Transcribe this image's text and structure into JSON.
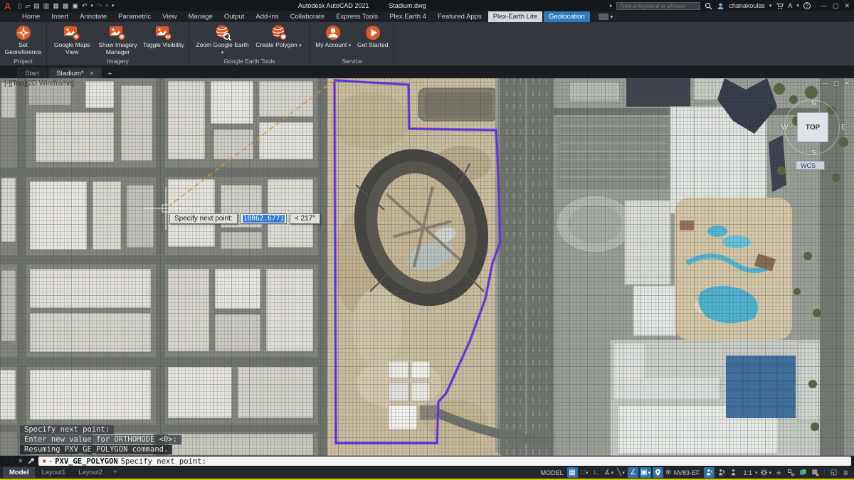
{
  "titlebar": {
    "app_logo": "A",
    "app_title": "Autodesk AutoCAD 2021",
    "doc_title": "Stadium.dwg",
    "search_placeholder": "Type a keyword or phrase",
    "username": "chanakoulas"
  },
  "ribbon_tabs": [
    {
      "label": "Home"
    },
    {
      "label": "Insert"
    },
    {
      "label": "Annotate"
    },
    {
      "label": "Parametric"
    },
    {
      "label": "View"
    },
    {
      "label": "Manage"
    },
    {
      "label": "Output"
    },
    {
      "label": "Add-ins"
    },
    {
      "label": "Collaborate"
    },
    {
      "label": "Express Tools"
    },
    {
      "label": "Plex.Earth 4"
    },
    {
      "label": "Featured Apps"
    },
    {
      "label": "Plex-Earth Lite"
    },
    {
      "label": "Geolocation"
    }
  ],
  "ribbon": {
    "groups": [
      {
        "title": "Project",
        "buttons": [
          {
            "label": "Set Georeference"
          }
        ]
      },
      {
        "title": "Imagery",
        "buttons": [
          {
            "label": "Google Maps View"
          },
          {
            "label": "Show Imagery Manager"
          },
          {
            "label": "Toggle Visibility"
          }
        ]
      },
      {
        "title": "Google Earth Tools",
        "buttons": [
          {
            "label": "Zoom Google Earth"
          },
          {
            "label": "Create Polygon"
          }
        ]
      },
      {
        "title": "Service",
        "buttons": [
          {
            "label": "My Account"
          },
          {
            "label": "Get Started"
          }
        ]
      }
    ]
  },
  "file_tabs": [
    {
      "label": "Start"
    },
    {
      "label": "Stadium*"
    }
  ],
  "canvas": {
    "viewport_label": "[-][Top][2D Wireframe]",
    "viewcube": {
      "n": "N",
      "s": "S",
      "e": "E",
      "w": "W",
      "face": "TOP",
      "wcs": "WCS"
    },
    "tooltip": {
      "label": "Specify next point:",
      "value": "18862.6771",
      "angle": "< 217°"
    },
    "history": [
      "Specify next point:",
      "Enter new value for ORTHOMODE <0>:",
      "Resuming PXV_GE_POLYGON command."
    ]
  },
  "command_bar": {
    "command": "PXV_GE_POLYGON",
    "prompt": "Specify next point:"
  },
  "status_bar": {
    "layout_tabs": [
      "Model",
      "Layout1",
      "Layout2"
    ],
    "model_label": "MODEL",
    "coord_system": "NV83-EF",
    "scale": "1:1"
  },
  "icons": {
    "caret": "▾",
    "close": "✕",
    "minimize": "—",
    "restore": "▢",
    "plus": "+",
    "arrow_right": "▸",
    "undo": "↶",
    "redo": "↷",
    "qat_new": "▯",
    "qat_open": "▱",
    "qat_save": "▤",
    "qat_saveas": "▥",
    "qat_plot": "▦",
    "qat_publish": "▩",
    "qat_print": "▣",
    "grip": "⋮⋮",
    "cmd_badge": "✱",
    "grid": "▦",
    "snap": "∷",
    "ortho": "∟",
    "polar": "∡",
    "isodraft": "╲",
    "osnap_track": "∠",
    "osnap": "▣",
    "globe": "⊕",
    "burger": "≡",
    "clean": "◱",
    "appstore": "A",
    "help": "?"
  },
  "accent_colors": {
    "contextual_tab": "#2f7cbc",
    "toggle_on": "#2f6fa8",
    "ribbon_icon": "#e05a26",
    "polygon": "#3a3af0"
  }
}
